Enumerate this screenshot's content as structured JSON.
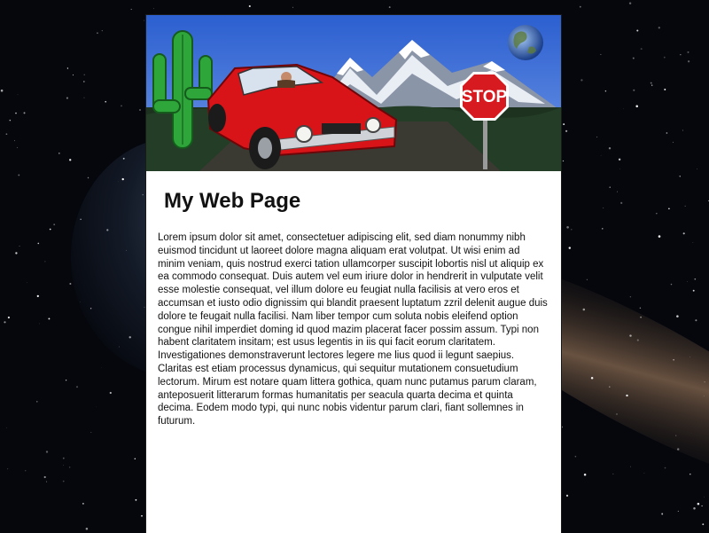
{
  "page": {
    "title": "My Web Page",
    "body": "Lorem ipsum dolor sit amet, consectetuer adipiscing elit, sed diam nonummy nibh euismod tincidunt ut laoreet dolore magna aliquam erat volutpat. Ut wisi enim ad minim veniam, quis nostrud exerci tation ullamcorper suscipit lobortis nisl ut aliquip ex ea commodo consequat. Duis autem vel eum iriure dolor in hendrerit in vulputate velit esse molestie consequat, vel illum dolore eu feugiat nulla facilisis at vero eros et accumsan et iusto odio dignissim qui blandit praesent luptatum zzril delenit augue duis dolore te feugait nulla facilisi. Nam liber tempor cum soluta nobis eleifend option congue nihil imperdiet doming id quod mazim placerat facer possim assum. Typi non habent claritatem insitam; est usus legentis in iis qui facit eorum claritatem. Investigationes demonstraverunt lectores legere me lius quod ii legunt saepius. Claritas est etiam processus dynamicus, qui sequitur mutationem consuetudium lectorum. Mirum est notare quam littera gothica, quam nunc putamus parum claram, anteposuerit litterarum formas humanitatis per seacula quarta decima et quinta decima. Eodem modo typi, qui nunc nobis videntur parum clari, fiant sollemnes in futurum."
  },
  "banner": {
    "stop_sign_text": "STOP",
    "icons": [
      "cactus-icon",
      "red-car-icon",
      "mountain-icon",
      "stop-sign-icon",
      "earth-globe-icon"
    ]
  },
  "colors": {
    "space_bg": "#05070d",
    "page_bg": "#ffffff",
    "sky": "#3f6fd6",
    "car_red": "#d81418",
    "stop_red": "#d71a20",
    "cactus_green": "#2fa63a"
  }
}
